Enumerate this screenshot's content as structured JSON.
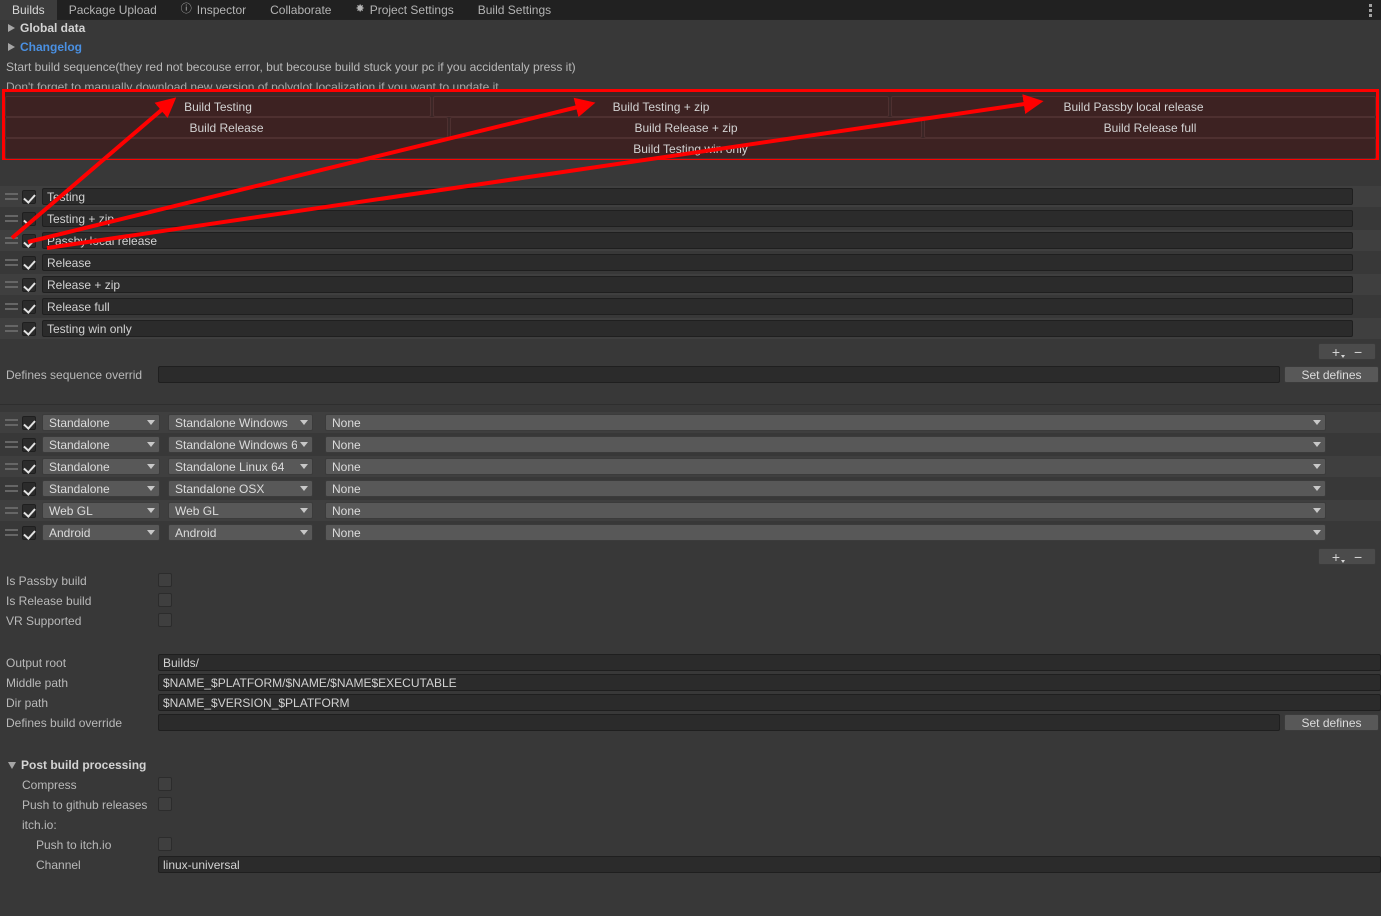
{
  "window": {
    "tabs": [
      {
        "label": "Builds",
        "icon": "",
        "active": true
      },
      {
        "label": "Package Upload",
        "icon": "",
        "active": false
      },
      {
        "label": "Inspector",
        "icon": "info-icon",
        "active": false
      },
      {
        "label": "Collaborate",
        "icon": "",
        "active": false
      },
      {
        "label": "Project Settings",
        "icon": "gear-icon",
        "active": false
      },
      {
        "label": "Build Settings",
        "icon": "",
        "active": false
      }
    ],
    "menu_icon": "kebab-menu-icon"
  },
  "header": {
    "global_data": "Global data",
    "changelog": "Changelog",
    "note1": "Start build sequence(they red not becouse error, but becouse build stuck your pc if you accidentaly press it)",
    "note2": "Don't forget to manually download new version of polyglot localization if you want to update it"
  },
  "build_buttons": {
    "row1": [
      "Build Testing",
      "Build Testing + zip",
      "Build Passby local release"
    ],
    "row2": [
      "Build Release",
      "Build Release + zip",
      "Build Release full"
    ],
    "row3": [
      "Build Testing win only"
    ],
    "highlight_color": "#ff0000",
    "button_color": "#3d2222"
  },
  "sequence_list": {
    "items": [
      {
        "checked": true,
        "name": "Testing"
      },
      {
        "checked": true,
        "name": "Testing + zip"
      },
      {
        "checked": true,
        "name": "Passby local release"
      },
      {
        "checked": true,
        "name": "Release"
      },
      {
        "checked": true,
        "name": "Release + zip"
      },
      {
        "checked": true,
        "name": "Release full"
      },
      {
        "checked": true,
        "name": "Testing win only"
      }
    ],
    "add_label": "+",
    "remove_label": "−"
  },
  "defines_sequence": {
    "label": "Defines sequence overrid",
    "value": "",
    "button": "Set defines"
  },
  "platform_list": {
    "rows": [
      {
        "checked": true,
        "group": "Standalone",
        "target": "Standalone Windows",
        "arch": "None"
      },
      {
        "checked": true,
        "group": "Standalone",
        "target": "Standalone Windows 6",
        "arch": "None"
      },
      {
        "checked": true,
        "group": "Standalone",
        "target": "Standalone Linux 64",
        "arch": "None"
      },
      {
        "checked": true,
        "group": "Standalone",
        "target": "Standalone OSX",
        "arch": "None"
      },
      {
        "checked": true,
        "group": "Web GL",
        "target": "Web GL",
        "arch": "None"
      },
      {
        "checked": true,
        "group": "Android",
        "target": "Android",
        "arch": "None"
      }
    ],
    "add_label": "+",
    "remove_label": "−"
  },
  "toggles": [
    {
      "label": "Is Passby build",
      "checked": false
    },
    {
      "label": "Is Release build",
      "checked": false
    },
    {
      "label": "VR Supported",
      "checked": false
    }
  ],
  "paths": [
    {
      "label": "Output root",
      "value": "Builds/"
    },
    {
      "label": "Middle path",
      "value": "$NAME_$PLATFORM/$NAME/$NAME$EXECUTABLE"
    },
    {
      "label": "Dir path",
      "value": "$NAME_$VERSION_$PLATFORM"
    }
  ],
  "defines_build": {
    "label": "Defines build override",
    "value": "",
    "button": "Set defines"
  },
  "post_build": {
    "title": "Post build processing",
    "compress": {
      "label": "Compress",
      "checked": false
    },
    "push_github": {
      "label": "Push to github releases",
      "checked": false
    },
    "itch_header": "itch.io:",
    "push_itch": {
      "label": "Push to itch.io",
      "checked": false
    },
    "channel": {
      "label": "Channel",
      "value": "linux-universal"
    }
  }
}
